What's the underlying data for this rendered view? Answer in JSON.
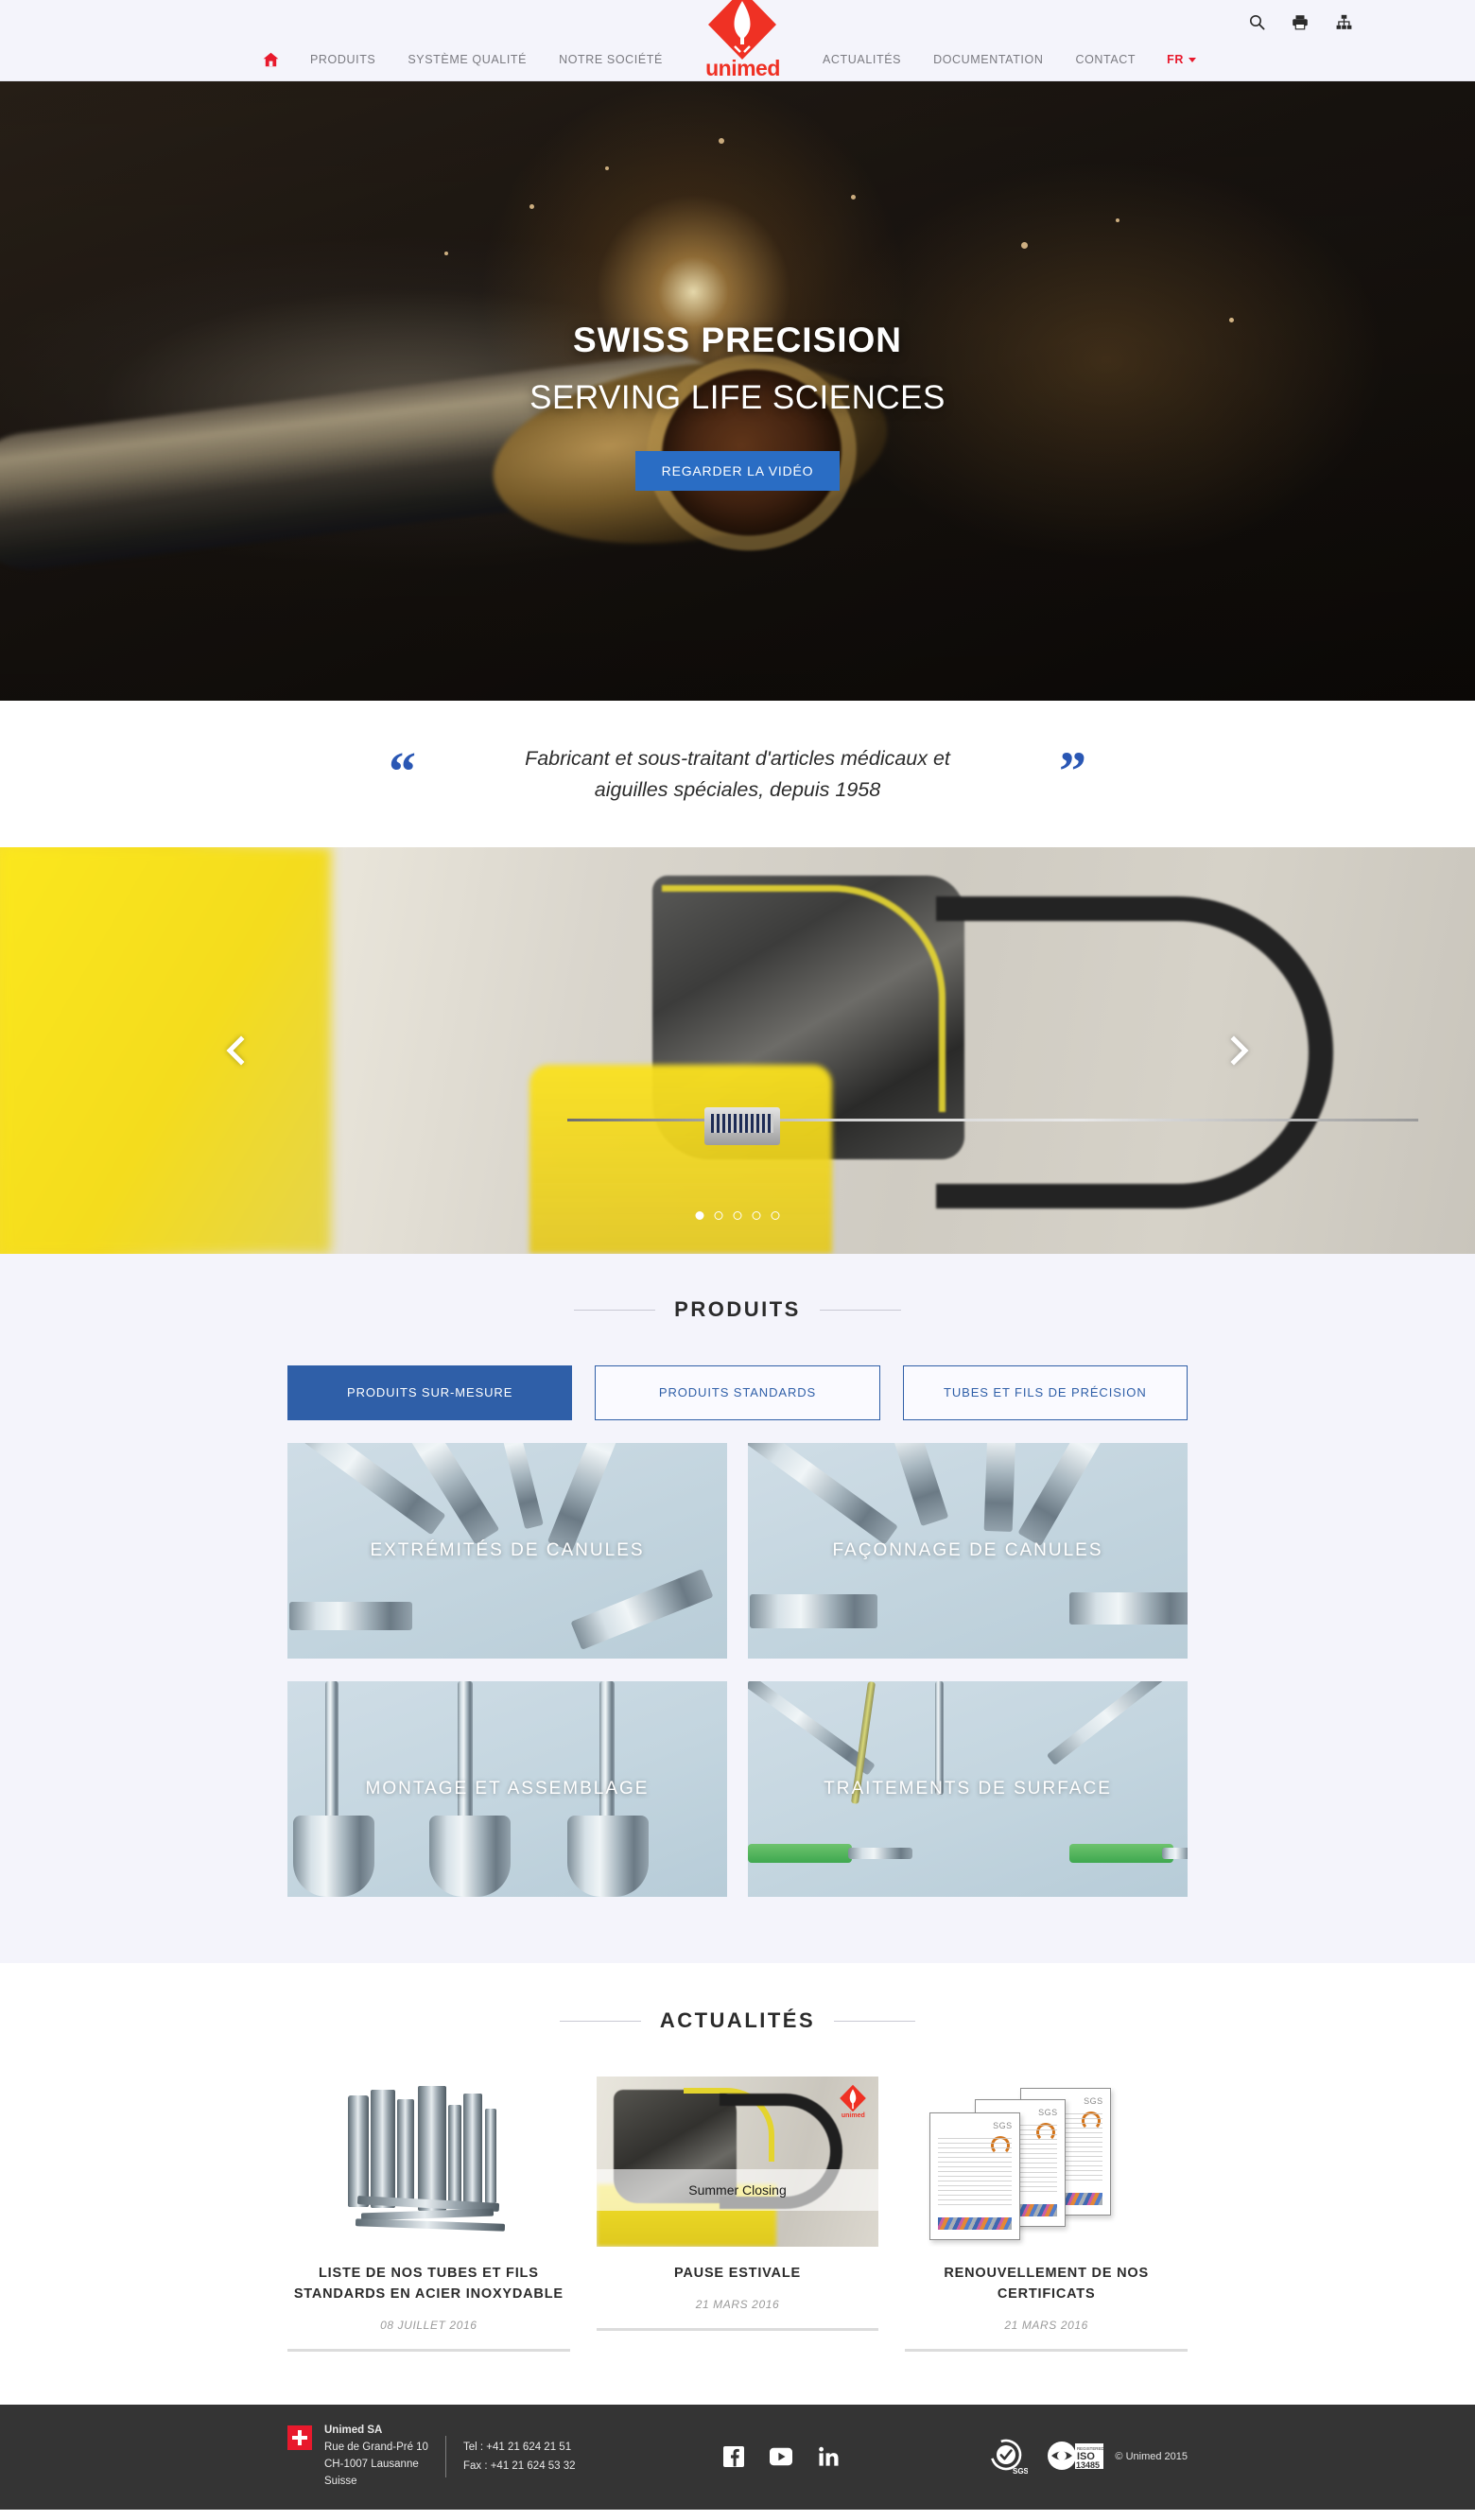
{
  "header": {
    "utility_icons": [
      {
        "name": "search-icon",
        "label": "Rechercher"
      },
      {
        "name": "print-icon",
        "label": "Imprimer"
      },
      {
        "name": "sitemap-icon",
        "label": "Plan du site"
      }
    ],
    "nav_left": [
      {
        "name": "home-icon",
        "label": ""
      },
      {
        "name": "nav-produits",
        "label": "PRODUITS"
      },
      {
        "name": "nav-systeme-qualite",
        "label": "SYSTÈME QUALITÉ"
      },
      {
        "name": "nav-notre-societe",
        "label": "NOTRE SOCIÉTÉ"
      }
    ],
    "nav_right": [
      {
        "name": "nav-actualites",
        "label": "ACTUALITÉS"
      },
      {
        "name": "nav-documentation",
        "label": "DOCUMENTATION"
      },
      {
        "name": "nav-contact",
        "label": "CONTACT"
      }
    ],
    "language": "FR",
    "logo_text": "unimed"
  },
  "hero": {
    "title": "SWISS PRECISION",
    "subtitle": "SERVING LIFE SCIENCES",
    "button_label": "REGARDER LA VIDÉO",
    "button_color": "#2a6dc4"
  },
  "quote": {
    "open_mark": "“",
    "close_mark": "”",
    "line1": "Fabricant et sous-traitant d'articles médicaux et",
    "line2": "aiguilles spéciales, depuis 1958",
    "mark_color": "#2a57b4"
  },
  "carousel": {
    "prev_label": "Précédent",
    "next_label": "Suivant",
    "slide_count": 5,
    "active_slide": 1
  },
  "produits": {
    "section_title": "PRODUITS",
    "tabs": [
      {
        "label": "PRODUITS SUR-MESURE",
        "active": true
      },
      {
        "label": "PRODUITS STANDARDS",
        "active": false
      },
      {
        "label": "TUBES ET FILS DE PRÉCISION",
        "active": false
      }
    ],
    "tiles": [
      {
        "label": "EXTRÉMITÉS DE CANULES"
      },
      {
        "label": "FAÇONNAGE DE CANULES"
      },
      {
        "label": "MONTAGE ET ASSEMBLAGE"
      },
      {
        "label": "TRAITEMENTS DE SURFACE"
      }
    ],
    "accent_color": "#2f5fa8",
    "background": "#f4f4fb"
  },
  "actualites": {
    "section_title": "ACTUALITÉS",
    "cards": [
      {
        "title": "LISTE DE NOS TUBES ET FILS STANDARDS EN ACIER INOXYDABLE",
        "date": "08 JUILLET 2016"
      },
      {
        "title": "PAUSE ESTIVALE",
        "date": "21 MARS 2016",
        "thumb_caption": "Summer Closing"
      },
      {
        "title": "RENOUVELLEMENT DE NOS CERTIFICATS",
        "date": "21 MARS 2016"
      }
    ]
  },
  "footer": {
    "company": "Unimed SA",
    "street": "Rue de Grand-Pré 10",
    "city": "CH-1007 Lausanne",
    "country": "Suisse",
    "tel": "Tel : +41 21 624 21 51",
    "fax": "Fax : +41 21 624 53 32",
    "social": [
      {
        "name": "facebook-icon",
        "label": "Facebook"
      },
      {
        "name": "youtube-icon",
        "label": "YouTube"
      },
      {
        "name": "linkedin-icon",
        "label": "LinkedIn"
      }
    ],
    "badges": [
      {
        "name": "sgs-badge",
        "label": "SGS"
      },
      {
        "name": "iso-13485-badge",
        "label": "ISO 13485"
      }
    ],
    "copyright": "© Unimed 2015",
    "background": "#343434"
  }
}
